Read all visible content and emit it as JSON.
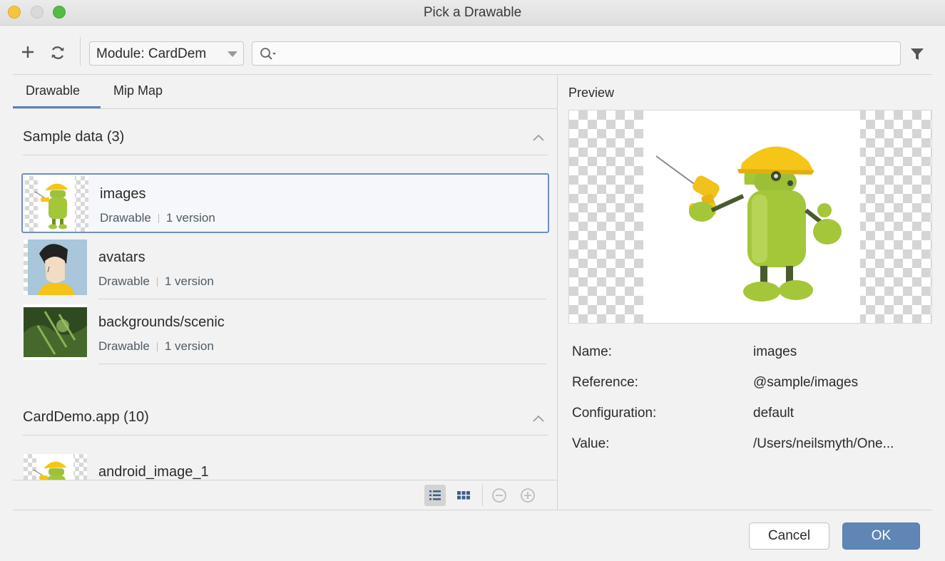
{
  "window": {
    "title": "Pick a Drawable"
  },
  "toolbar": {
    "add_icon": "plus-icon",
    "refresh_icon": "refresh-icon",
    "module_label": "Module: CardDem",
    "search_value": "",
    "search_placeholder": "",
    "filter_icon": "filter-icon"
  },
  "tabs": [
    {
      "label": "Drawable",
      "selected": true
    },
    {
      "label": "Mip Map",
      "selected": false
    }
  ],
  "groups": [
    {
      "title": "Sample data (3)",
      "items": [
        {
          "name": "images",
          "type": "Drawable",
          "versions": "1 version",
          "selected": true
        },
        {
          "name": "avatars",
          "type": "Drawable",
          "versions": "1 version",
          "selected": false
        },
        {
          "name": "backgrounds/scenic",
          "type": "Drawable",
          "versions": "1 version",
          "selected": false
        }
      ]
    },
    {
      "title": "CardDemo.app (10)",
      "items": [
        {
          "name": "android_image_1"
        }
      ]
    }
  ],
  "listbar": {
    "list_view_icon": "list-view-icon",
    "grid_view_icon": "grid-view-icon",
    "zoom_out_icon": "zoom-out-icon",
    "zoom_in_icon": "zoom-in-icon"
  },
  "preview": {
    "label": "Preview",
    "properties": [
      {
        "label": "Name:",
        "value": "images"
      },
      {
        "label": "Reference:",
        "value": "@sample/images"
      },
      {
        "label": "Configuration:",
        "value": "default"
      },
      {
        "label": "Value:",
        "value": "/Users/neilsmyth/One..."
      }
    ]
  },
  "buttons": {
    "cancel": "Cancel",
    "ok": "OK"
  },
  "colors": {
    "accent": "#5b82b8",
    "ok_button": "#5f86b5",
    "android_green": "#a4c639",
    "hard_hat": "#f5c518"
  }
}
